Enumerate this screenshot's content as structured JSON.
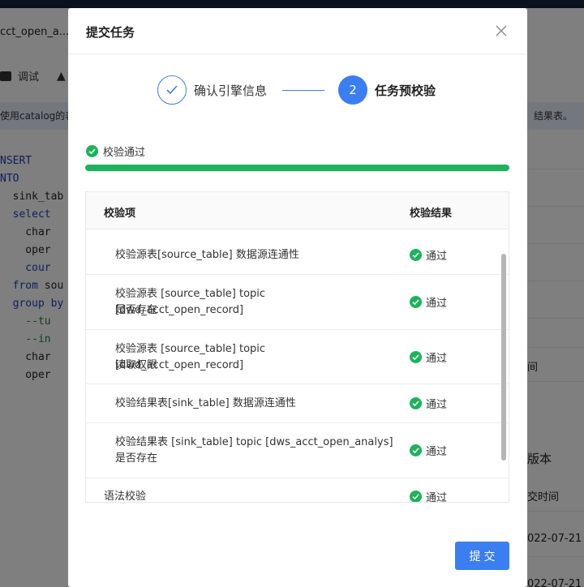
{
  "background": {
    "tab_title": "cct_open_a...",
    "toolbar_debug": "调试",
    "notice_left": "使用catalog的表",
    "notice_right": "结果表。",
    "code": {
      "insert": "NSERT",
      "into": "NTO",
      "sink": "  sink_tab",
      "select": "  select",
      "l1": "    char",
      "l2": "    oper",
      "l3": "    cour",
      "from_kw": "  from",
      "from_rest": " sou",
      "group": "  group by",
      "c1": "    --tu",
      "c2": "    --in",
      "l4": "    char",
      "l5": "    oper"
    },
    "right_panel": {
      "time_label": "间",
      "version_heading": "版本",
      "submit_time_label": "交时间",
      "date1": "022-07-21",
      "date2": "022-07-21"
    }
  },
  "modal": {
    "title": "提交任务",
    "close_label": "×",
    "steps": [
      {
        "label": "确认引擎信息"
      },
      {
        "number": "2",
        "label": "任务预校验"
      }
    ],
    "status_text": "校验通过",
    "progress": 1.0,
    "table": {
      "col_item": "校验项",
      "col_result": "校验结果",
      "rows": [
        {
          "line1": "校验源表[source_table] 数据源连通性",
          "line2": "",
          "result": "通过"
        },
        {
          "line1": "校验源表 [source_table] topic [dwd_acct_open_record]",
          "line2": "是否存在",
          "result": "通过"
        },
        {
          "line1": "校验源表 [source_table] topic [dwd_acct_open_record]",
          "line2": "读取权限",
          "result": "通过"
        },
        {
          "line1": "校验结果表[sink_table] 数据源连通性",
          "line2": "",
          "result": "通过"
        },
        {
          "line1": "校验结果表 [sink_table] topic [dws_acct_open_analys]",
          "line2": "是否存在",
          "result": "通过"
        },
        {
          "line1": "语法校验",
          "line2": "",
          "result": "通过"
        }
      ]
    },
    "submit_label": "提交"
  },
  "colors": {
    "primary": "#3b7ef2",
    "success": "#1cb35b"
  }
}
